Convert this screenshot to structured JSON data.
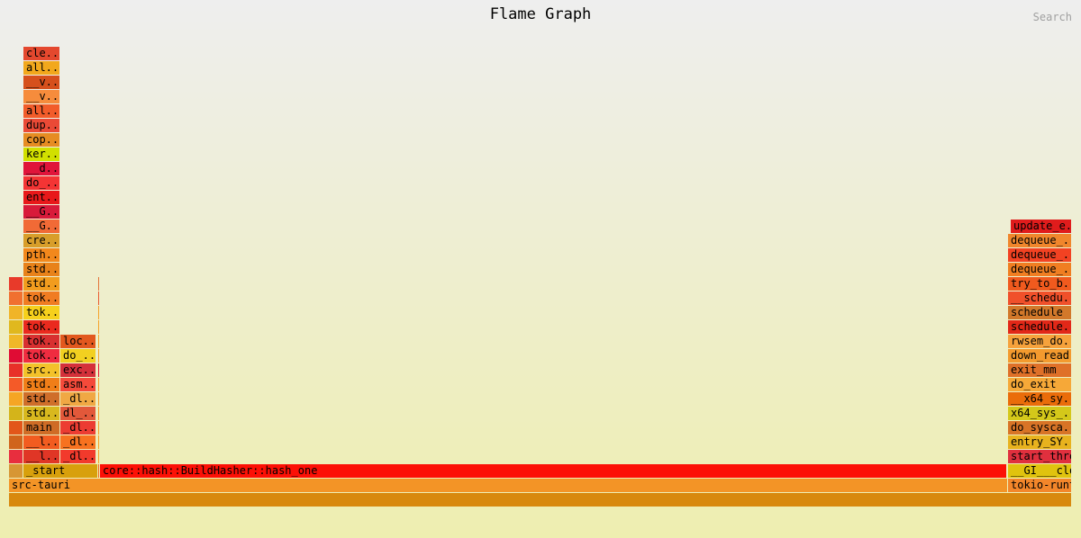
{
  "header": {
    "title": "Flame Graph",
    "search_label": "Search"
  },
  "frames": [
    {
      "name": "",
      "depth": 0,
      "start": 0,
      "end": 1180,
      "color": "#d8890e"
    },
    {
      "name": "src-tauri",
      "depth": 1,
      "start": 0,
      "end": 1109,
      "color": "#f39426"
    },
    {
      "name": "tokio-runt",
      "depth": 1,
      "start": 1109,
      "end": 1180,
      "color": "#f3862a"
    },
    {
      "name": "",
      "depth": 2,
      "start": 0,
      "end": 16,
      "color": "#d79634"
    },
    {
      "name": "_start",
      "depth": 2,
      "start": 16,
      "end": 99,
      "color": "#d8a00c"
    },
    {
      "name": "",
      "depth": 2,
      "start": 99,
      "end": 101,
      "color": "#f06a20"
    },
    {
      "name": "core::hash::BuildHasher::hash_one",
      "depth": 2,
      "start": 101,
      "end": 1108,
      "color": "#fc1006"
    },
    {
      "name": "__GI___clo",
      "depth": 2,
      "start": 1109,
      "end": 1180,
      "color": "#e0c30e"
    },
    {
      "name": "",
      "depth": 3,
      "start": 0,
      "end": 16,
      "color": "#e82e3e"
    },
    {
      "name": "__l..",
      "depth": 3,
      "start": 16,
      "end": 57,
      "color": "#e03626"
    },
    {
      "name": "_dl..",
      "depth": 3,
      "start": 57,
      "end": 97,
      "color": "#f23a2c"
    },
    {
      "name": "",
      "depth": 3,
      "start": 99,
      "end": 101,
      "color": "#f6a22a"
    },
    {
      "name": "start_thre",
      "depth": 3,
      "start": 1109,
      "end": 1180,
      "color": "#e0303e"
    },
    {
      "name": "",
      "depth": 4,
      "start": 0,
      "end": 16,
      "color": "#d0641c"
    },
    {
      "name": "__l..",
      "depth": 4,
      "start": 16,
      "end": 57,
      "color": "#f25c20"
    },
    {
      "name": "_dl..",
      "depth": 4,
      "start": 57,
      "end": 97,
      "color": "#f77220"
    },
    {
      "name": "",
      "depth": 4,
      "start": 99,
      "end": 101,
      "color": "#f6a22a"
    },
    {
      "name": "entry_SY..",
      "depth": 4,
      "start": 1109,
      "end": 1180,
      "color": "#e8b21e"
    },
    {
      "name": "",
      "depth": 5,
      "start": 0,
      "end": 16,
      "color": "#e2561a"
    },
    {
      "name": "main",
      "depth": 5,
      "start": 16,
      "end": 57,
      "color": "#cf6c26"
    },
    {
      "name": "_dl..",
      "depth": 5,
      "start": 57,
      "end": 97,
      "color": "#ec3c32"
    },
    {
      "name": "",
      "depth": 5,
      "start": 99,
      "end": 101,
      "color": "#f6a22a"
    },
    {
      "name": "do_sysca..",
      "depth": 5,
      "start": 1109,
      "end": 1180,
      "color": "#d87426"
    },
    {
      "name": "",
      "depth": 6,
      "start": 0,
      "end": 16,
      "color": "#d4b41a"
    },
    {
      "name": "std..",
      "depth": 6,
      "start": 16,
      "end": 57,
      "color": "#d8b81e"
    },
    {
      "name": "dl_..",
      "depth": 6,
      "start": 57,
      "end": 97,
      "color": "#e2583a"
    },
    {
      "name": "",
      "depth": 6,
      "start": 99,
      "end": 101,
      "color": "#f6a22a"
    },
    {
      "name": "x64_sys_..",
      "depth": 6,
      "start": 1109,
      "end": 1180,
      "color": "#d4c81a"
    },
    {
      "name": "",
      "depth": 7,
      "start": 0,
      "end": 16,
      "color": "#f5a524"
    },
    {
      "name": "std..",
      "depth": 7,
      "start": 16,
      "end": 57,
      "color": "#cf6e2a"
    },
    {
      "name": "_dl..",
      "depth": 7,
      "start": 57,
      "end": 97,
      "color": "#f0a844"
    },
    {
      "name": "",
      "depth": 7,
      "start": 99,
      "end": 101,
      "color": "#f6a22a"
    },
    {
      "name": "__x64_sy..",
      "depth": 7,
      "start": 1109,
      "end": 1180,
      "color": "#ea6c0a"
    },
    {
      "name": "",
      "depth": 8,
      "start": 0,
      "end": 16,
      "color": "#f45a28"
    },
    {
      "name": "std..",
      "depth": 8,
      "start": 16,
      "end": 57,
      "color": "#f07e18"
    },
    {
      "name": "asm..",
      "depth": 8,
      "start": 57,
      "end": 97,
      "color": "#f44a3a"
    },
    {
      "name": "",
      "depth": 8,
      "start": 99,
      "end": 101,
      "color": "#f6a22a"
    },
    {
      "name": "do_exit",
      "depth": 8,
      "start": 1109,
      "end": 1180,
      "color": "#f6a838"
    },
    {
      "name": "",
      "depth": 9,
      "start": 0,
      "end": 16,
      "color": "#e83028"
    },
    {
      "name": "src..",
      "depth": 9,
      "start": 16,
      "end": 57,
      "color": "#f3c22a"
    },
    {
      "name": "exc..",
      "depth": 9,
      "start": 57,
      "end": 97,
      "color": "#d4303a"
    },
    {
      "name": "",
      "depth": 9,
      "start": 99,
      "end": 101,
      "color": "#e81a30"
    },
    {
      "name": "exit_mm",
      "depth": 9,
      "start": 1109,
      "end": 1180,
      "color": "#df7028"
    },
    {
      "name": "",
      "depth": 10,
      "start": 0,
      "end": 16,
      "color": "#e00c34"
    },
    {
      "name": "tok..",
      "depth": 10,
      "start": 16,
      "end": 57,
      "color": "#f02c40"
    },
    {
      "name": "do_..",
      "depth": 10,
      "start": 57,
      "end": 97,
      "color": "#f2d020"
    },
    {
      "name": "",
      "depth": 10,
      "start": 99,
      "end": 101,
      "color": "#f6a22a"
    },
    {
      "name": "down_read",
      "depth": 10,
      "start": 1109,
      "end": 1180,
      "color": "#f39a2e"
    },
    {
      "name": "",
      "depth": 11,
      "start": 0,
      "end": 16,
      "color": "#f0b828"
    },
    {
      "name": "tok..",
      "depth": 11,
      "start": 16,
      "end": 57,
      "color": "#d83030"
    },
    {
      "name": "loc..",
      "depth": 11,
      "start": 57,
      "end": 97,
      "color": "#e2581e"
    },
    {
      "name": "",
      "depth": 11,
      "start": 99,
      "end": 101,
      "color": "#f6a22a"
    },
    {
      "name": "rwsem_do..",
      "depth": 11,
      "start": 1109,
      "end": 1180,
      "color": "#f6a23c"
    },
    {
      "name": "",
      "depth": 12,
      "start": 0,
      "end": 16,
      "color": "#e0b81e"
    },
    {
      "name": "tok..",
      "depth": 12,
      "start": 16,
      "end": 57,
      "color": "#ea2a1e"
    },
    {
      "name": "",
      "depth": 12,
      "start": 99,
      "end": 101,
      "color": "#f6a22a"
    },
    {
      "name": "schedule..",
      "depth": 12,
      "start": 1109,
      "end": 1180,
      "color": "#e22818"
    },
    {
      "name": "",
      "depth": 13,
      "start": 0,
      "end": 16,
      "color": "#f0b428"
    },
    {
      "name": "tok..",
      "depth": 13,
      "start": 16,
      "end": 57,
      "color": "#f6d01c"
    },
    {
      "name": "",
      "depth": 13,
      "start": 99,
      "end": 101,
      "color": "#f6a22a"
    },
    {
      "name": "schedule",
      "depth": 13,
      "start": 1109,
      "end": 1180,
      "color": "#d2782a"
    },
    {
      "name": "",
      "depth": 14,
      "start": 0,
      "end": 16,
      "color": "#f07030"
    },
    {
      "name": "tok..",
      "depth": 14,
      "start": 16,
      "end": 57,
      "color": "#f07c22"
    },
    {
      "name": "",
      "depth": 14,
      "start": 99,
      "end": 101,
      "color": "#ea5c30"
    },
    {
      "name": "__schedu..",
      "depth": 14,
      "start": 1109,
      "end": 1180,
      "color": "#f0502a"
    },
    {
      "name": "",
      "depth": 15,
      "start": 0,
      "end": 16,
      "color": "#e83a2a"
    },
    {
      "name": "std..",
      "depth": 15,
      "start": 16,
      "end": 57,
      "color": "#f29c1e"
    },
    {
      "name": "",
      "depth": 15,
      "start": 99,
      "end": 101,
      "color": "#e4743a"
    },
    {
      "name": "try_to_b..",
      "depth": 15,
      "start": 1109,
      "end": 1180,
      "color": "#f05a1e"
    },
    {
      "name": "std..",
      "depth": 16,
      "start": 16,
      "end": 57,
      "color": "#e8821a"
    },
    {
      "name": "dequeue_..",
      "depth": 16,
      "start": 1109,
      "end": 1180,
      "color": "#f07e22"
    },
    {
      "name": "pth..",
      "depth": 17,
      "start": 16,
      "end": 57,
      "color": "#f2881c"
    },
    {
      "name": "dequeue_..",
      "depth": 17,
      "start": 1109,
      "end": 1180,
      "color": "#f24222"
    },
    {
      "name": "cre..",
      "depth": 18,
      "start": 16,
      "end": 57,
      "color": "#d89e2a"
    },
    {
      "name": "dequeue_..",
      "depth": 18,
      "start": 1109,
      "end": 1180,
      "color": "#f0862c"
    },
    {
      "name": "__G..",
      "depth": 19,
      "start": 16,
      "end": 57,
      "color": "#f16a36"
    },
    {
      "name": "update_e..",
      "depth": 19,
      "start": 1112,
      "end": 1180,
      "color": "#e01c1c"
    },
    {
      "name": "__G..",
      "depth": 20,
      "start": 16,
      "end": 57,
      "color": "#d81a3a"
    },
    {
      "name": "ent..",
      "depth": 21,
      "start": 16,
      "end": 57,
      "color": "#e8181a"
    },
    {
      "name": "do_..",
      "depth": 22,
      "start": 16,
      "end": 57,
      "color": "#f43434"
    },
    {
      "name": "__d..",
      "depth": 23,
      "start": 16,
      "end": 57,
      "color": "#e0143a"
    },
    {
      "name": "ker..",
      "depth": 24,
      "start": 16,
      "end": 57,
      "color": "#d2e000"
    },
    {
      "name": "cop..",
      "depth": 25,
      "start": 16,
      "end": 57,
      "color": "#e68c22"
    },
    {
      "name": "dup..",
      "depth": 26,
      "start": 16,
      "end": 57,
      "color": "#ea4a36"
    },
    {
      "name": "all..",
      "depth": 27,
      "start": 16,
      "end": 57,
      "color": "#f25c2a"
    },
    {
      "name": "__v..",
      "depth": 28,
      "start": 16,
      "end": 57,
      "color": "#f68c3c"
    },
    {
      "name": "__v..",
      "depth": 29,
      "start": 16,
      "end": 57,
      "color": "#d6501c"
    },
    {
      "name": "all..",
      "depth": 30,
      "start": 16,
      "end": 57,
      "color": "#f2a81c"
    },
    {
      "name": "cle..",
      "depth": 31,
      "start": 16,
      "end": 57,
      "color": "#e4482e"
    }
  ]
}
